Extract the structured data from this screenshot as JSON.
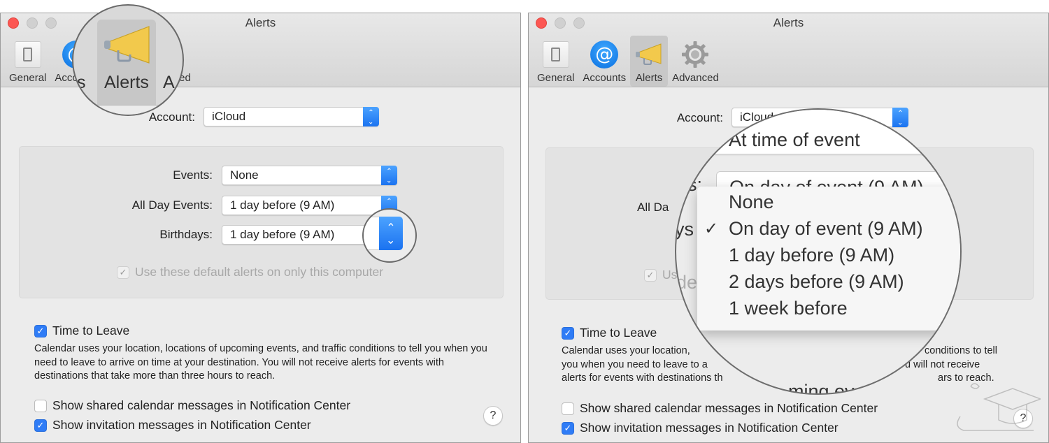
{
  "left_window": {
    "title": "Alerts",
    "toolbar": [
      {
        "label": "General",
        "icon": "general-switch-icon"
      },
      {
        "label": "Accounts",
        "icon": "accounts-at-icon"
      },
      {
        "label": "Alerts",
        "icon": "megaphone-icon",
        "selected": true
      },
      {
        "label": "Advanced",
        "icon": "gear-icon"
      }
    ],
    "magnifier": {
      "label": "Alerts",
      "left_fragment": "ts",
      "right_fragment": "A"
    },
    "account_label": "Account:",
    "account_value": "iCloud",
    "events_label": "Events:",
    "events_value": "None",
    "all_day_label": "All Day Events:",
    "all_day_value": "1 day before (9 AM)",
    "birthdays_label": "Birthdays:",
    "birthdays_value": "1 day before (9 AM)",
    "use_default_label": "Use these default alerts on only this computer",
    "use_default_checked": true,
    "time_to_leave_label": "Time to Leave",
    "time_to_leave_checked": true,
    "time_to_leave_desc": "Calendar uses your location, locations of upcoming events, and traffic conditions to tell you when you need to leave to arrive on time at your destination. You will not receive alerts for events with destinations that take more than three hours to reach.",
    "shared_label": "Show shared calendar messages in Notification Center",
    "shared_checked": false,
    "invitation_label": "Show invitation messages in Notification Center",
    "invitation_checked": true,
    "help_label": "?"
  },
  "right_window": {
    "title": "Alerts",
    "toolbar": [
      {
        "label": "General",
        "icon": "general-switch-icon"
      },
      {
        "label": "Accounts",
        "icon": "accounts-at-icon"
      },
      {
        "label": "Alerts",
        "icon": "megaphone-icon",
        "selected": true
      },
      {
        "label": "Advanced",
        "icon": "gear-icon"
      }
    ],
    "account_label": "Account:",
    "account_value": "iCloud",
    "all_day_fragment": "All Da",
    "use_fragment": "Us",
    "magnifier": {
      "top_item": "At time of event",
      "behind_popup_value": "On day of event (9 AM)",
      "label_fragment_1": "s:",
      "label_fragment_2": "ys",
      "label_fragment_3": "de",
      "bottom_fragment": "ming ev",
      "menu_items": [
        {
          "label": "None",
          "checked": false
        },
        {
          "label": "On day of event (9 AM)",
          "checked": true
        },
        {
          "label": "1 day before (9 AM)",
          "checked": false
        },
        {
          "label": "2 days before (9 AM)",
          "checked": false
        },
        {
          "label": "1 week before",
          "checked": false
        }
      ],
      "check_glyph": "✓"
    },
    "time_to_leave_label": "Time to Leave",
    "time_to_leave_checked": true,
    "desc_line1_left": "Calendar uses your location, ",
    "desc_line1_right": "conditions to tell",
    "desc_line2_left": "you when you need to leave to a",
    "desc_line2_right": "u will not receive",
    "desc_line3_left": "alerts for events with destinations th",
    "desc_line3_right": "ars to reach.",
    "shared_label": "Show shared calendar messages in Notification Center",
    "shared_checked": false,
    "invitation_label": "Show invitation messages in Notification Center",
    "invitation_checked": true,
    "help_label": "?"
  },
  "colors": {
    "accent_blue": "#2f7cf6",
    "close_red": "#fc5753",
    "window_bg": "#ececec",
    "group_bg": "#e3e3e3"
  }
}
